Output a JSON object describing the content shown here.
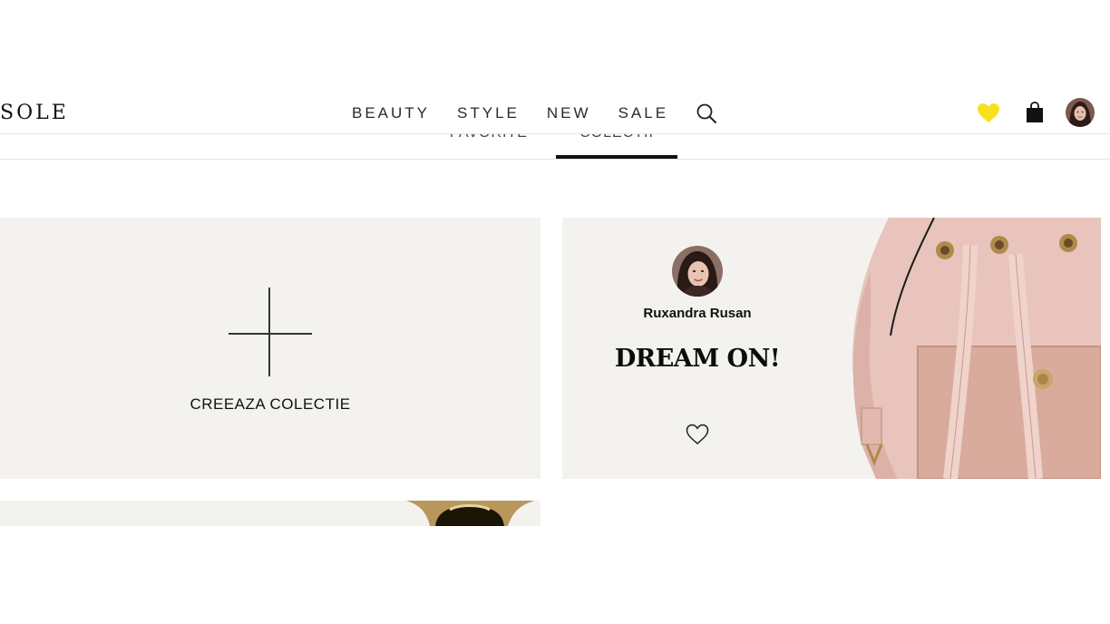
{
  "brand": {
    "logo": "SOLE"
  },
  "nav": {
    "items": [
      "BEAUTY",
      "STYLE",
      "NEW",
      "SALE"
    ]
  },
  "header": {
    "icons": [
      "search-icon",
      "heart-icon",
      "shopping-bag-icon",
      "user-avatar"
    ],
    "favorites_color": "#f7e11b"
  },
  "tabs": {
    "favorites": "FAVORITE",
    "collections": "COLECTII",
    "active": "collections"
  },
  "create_card": {
    "label": "CREEAZA COLECTIE"
  },
  "collection_card": {
    "user_name": "Ruxandra Rusan",
    "title": "DREAM ON!"
  },
  "colors": {
    "card_bg": "#f3f2ee",
    "bag_pink": "#e8c4bc"
  }
}
